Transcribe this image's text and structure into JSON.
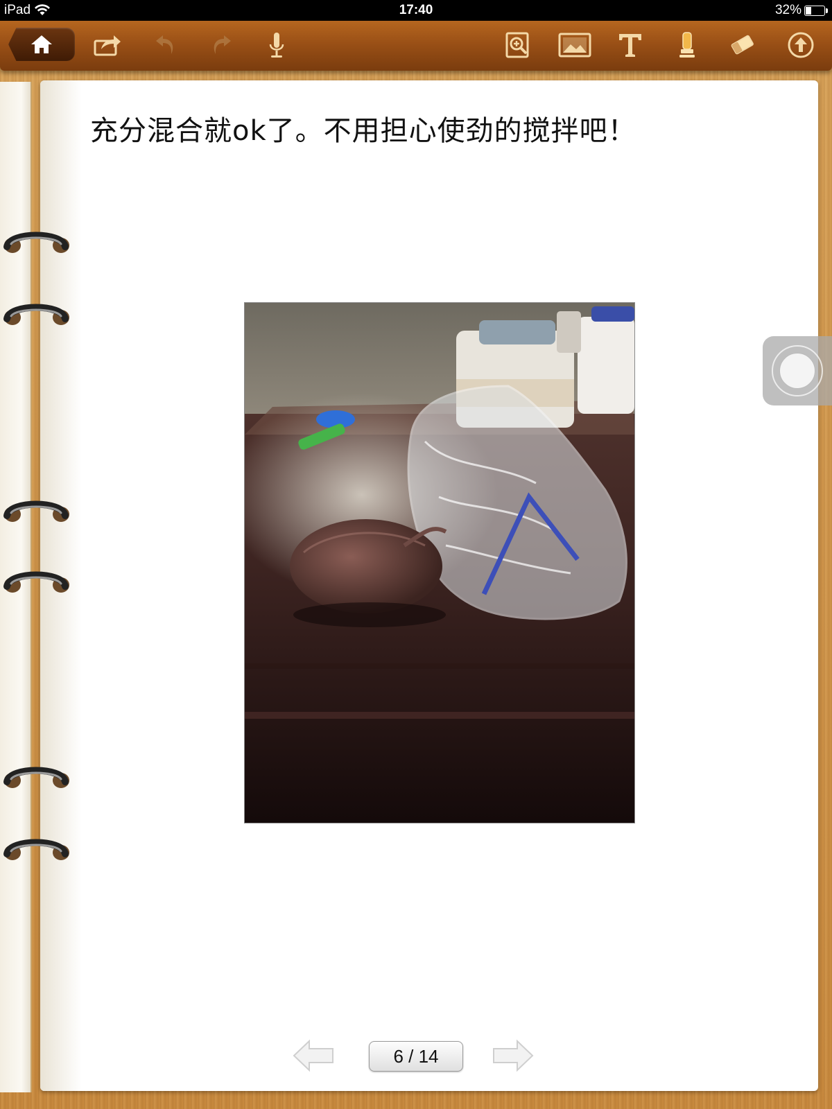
{
  "status_bar": {
    "device": "iPad",
    "time": "17:40",
    "battery_text": "32%",
    "battery_level": 0.32
  },
  "toolbar": {
    "buttons": [
      {
        "icon": "home-icon"
      },
      {
        "icon": "share-icon"
      },
      {
        "icon": "undo-icon"
      },
      {
        "icon": "redo-icon"
      },
      {
        "icon": "microphone-icon"
      },
      {
        "icon": "zoom-page-icon"
      },
      {
        "icon": "image-icon"
      },
      {
        "icon": "text-icon"
      },
      {
        "icon": "highlighter-icon"
      },
      {
        "icon": "eraser-icon"
      },
      {
        "icon": "upload-icon"
      }
    ]
  },
  "page": {
    "text": "充分混合就ok了。不用担心使劲的搅拌吧！"
  },
  "pager": {
    "current": 6,
    "total": 14,
    "label": "6 / 14"
  },
  "colors": {
    "toolbar": "#9a5016",
    "wood": "#c98a3e",
    "page": "#ffffff"
  }
}
